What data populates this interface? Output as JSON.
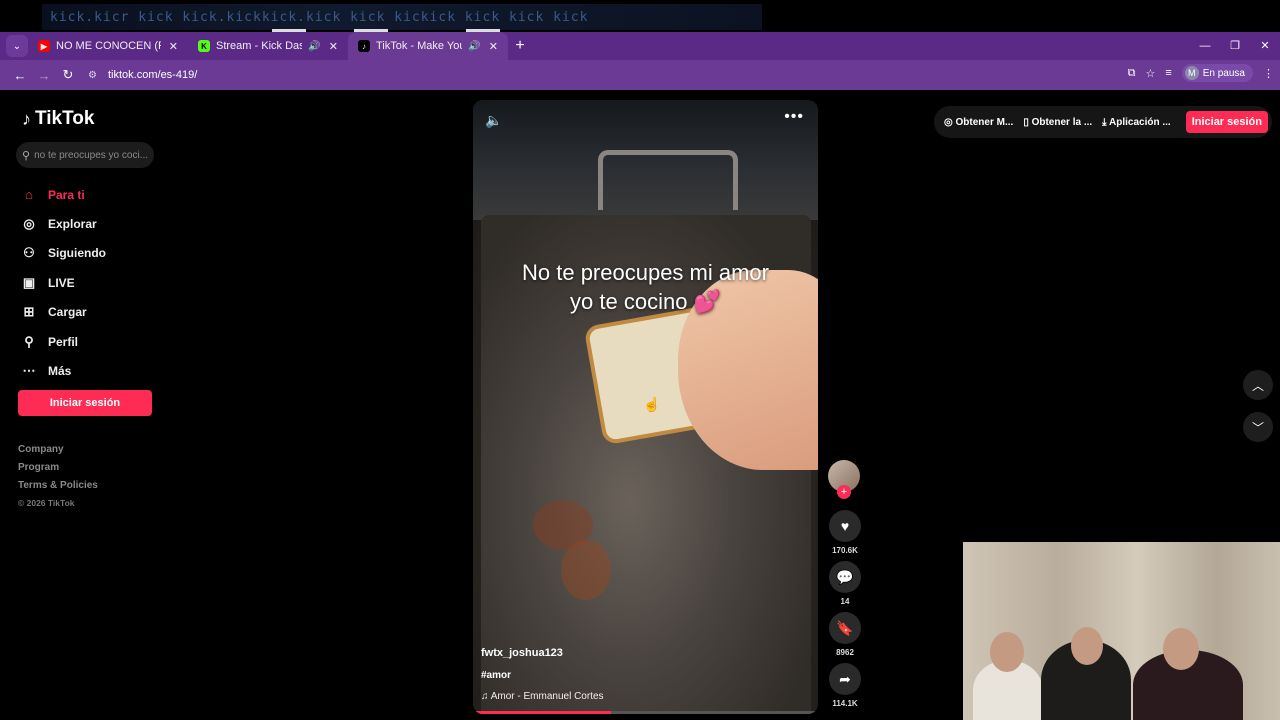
{
  "stream_overlay": {
    "glitch_text": "kick.kicr kick kick.kickkick.kick kick kickick kick kick kick"
  },
  "browser": {
    "tabs": [
      {
        "title": "NO ME CONOCEN (REMIX) - Ba",
        "favicon_color": "#ff0000",
        "active": false,
        "audio": false
      },
      {
        "title": "Stream - Kick Dashboard",
        "favicon_color": "#53fc18",
        "active": false,
        "audio": true
      },
      {
        "title": "TikTok - Make Your Day",
        "favicon_color": "#000000",
        "active": true,
        "audio": true
      }
    ],
    "url": "tiktok.com/es-419/",
    "profile_initial": "M",
    "profile_status": "En pausa",
    "accent_color": "#6a3a94"
  },
  "sidebar": {
    "logo": "TikTok",
    "search_placeholder": "no te preocupes yo coci...",
    "nav": [
      {
        "label": "Para ti",
        "icon": "home-icon",
        "glyph": "⌂",
        "active": true
      },
      {
        "label": "Explorar",
        "icon": "compass-icon",
        "glyph": "◎",
        "active": false
      },
      {
        "label": "Siguiendo",
        "icon": "following-icon",
        "glyph": "⚇",
        "active": false
      },
      {
        "label": "LIVE",
        "icon": "live-icon",
        "glyph": "▣",
        "active": false
      },
      {
        "label": "Cargar",
        "icon": "upload-icon",
        "glyph": "⊞",
        "active": false
      },
      {
        "label": "Perfil",
        "icon": "profile-icon",
        "glyph": "⚲",
        "active": false
      },
      {
        "label": "Más",
        "icon": "more-icon",
        "glyph": "⋯",
        "active": false
      }
    ],
    "login_button": "Iniciar sesión",
    "footer": [
      "Company",
      "Program",
      "Terms & Policies"
    ],
    "copyright": "© 2026 TikTok"
  },
  "video": {
    "caption_line1": "No te preocupes mi amor",
    "caption_line2": "yo te cocino 💕",
    "username": "fwtx_joshua123",
    "hashtag": "#amor",
    "music": "Amor - Emmanuel Cortes",
    "progress": 0.4
  },
  "actions": {
    "likes": "170.6K",
    "comments": "14",
    "saves": "8962",
    "shares": "114.1K"
  },
  "topbar": {
    "buttons": [
      "Obtener M...",
      "Obtener la ...",
      "Aplicación ..."
    ],
    "login": "Iniciar sesión"
  },
  "brand_color": "#fe2c55"
}
